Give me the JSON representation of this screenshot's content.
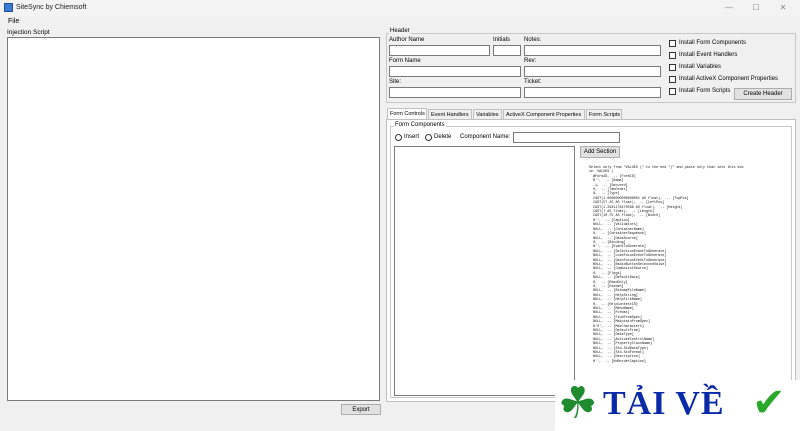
{
  "window": {
    "title": "SiteSync by Chiemsoft",
    "min_glyph": "—",
    "max_glyph": "☐",
    "close_glyph": "✕"
  },
  "menu": {
    "file": "File"
  },
  "injection": {
    "label": "Injection Script"
  },
  "export_button": "Export",
  "header": {
    "group_label": "Header",
    "author_label": "Author Name",
    "initials_label": "Initials",
    "notes_label": "Notes:",
    "form_name_label": "Form Name",
    "rev_label": "Rev:",
    "site_label": "Site:",
    "ticket_label": "Ticket:",
    "checkboxes": [
      "Install Form Components",
      "Install Event Handlers",
      "Install Variables",
      "Install ActiveX Component Properties",
      "Install Form Scripts"
    ],
    "create_button": "Create Header"
  },
  "tabs": [
    "Form Controls",
    "Event Handlers",
    "Variables",
    "ActiveX Component Properties",
    "Form Scripts"
  ],
  "form_components": {
    "group_label": "Form Components",
    "insert_label": "Insert",
    "delete_label": "Delete",
    "component_name_label": "Component Name:",
    "add_section_button": "Add Section",
    "script_text": "Select only from \"VALUES (\" to the end \")\" and paste only that into this box\nie. VALUES (\n  @FormID,  -- [FormID]\n  N'',  -- [Name]\n  -1,  -- [Secured]\n  0,  -- [TabOrder]\n  8,  -- [Type]\n  CAST(1.0800000000000001 AS float),  -- [TopPos]\n  CAST(57.25 AS float),  -- [LeftPos]\n  CAST(1.2941176470588 AS float),  -- [Height]\n  CAST(7 AS float),  -- [Length]\n  CAST(10.75 AS float),  -- [Width]\n  N'',  -- [Caption]\n  NULL,  -- [Validators]\n  NULL,  -- [ContainerName]\n  0,  -- [ContainerSequence]\n  NULL,  -- [DataSource]\n  0,  -- [Binding]\n  N'',  -- [EventToGenerate]\n  NULL,  -- [SelectionEventToGenerate]\n  NULL,  -- [LoseFocusEventToGenerate]\n  NULL,  -- [GainFocusEventToGenerate]\n  NULL,  -- [RadioButtonSelectedValue]\n  NULL,  -- [ComboListSource]\n  0,  -- [Flags]\n  NULL,  -- [DefaultData]\n  0,  -- [ReadOnly]\n  0,  -- [Hidden]\n  NULL,  -- [BitmapFileName]\n  NULL,  -- [HelpString]\n  NULL,  -- [HelpFileName]\n  0,  -- [HelpContextID]\n  NULL,  -- [MenuName]\n  NULL,  -- [Format]\n  NULL,  -- [FindFromSpec]\n  NULL,  -- [MaintainFromSpec]\n  N'0',  -- [MaxCharacters]\n  NULL,  -- [DefaultFrom]\n  NULL,  -- [DataType]\n  NULL,  -- [ActiveXControlName]\n  NULL,  -- [PropertyClassName]\n  NULL,  -- [Std.StdDataType]\n  NULL,  -- [Std.StdFormat]\n  NULL,  -- [Description]\n  N'',  -- [NoBorderCaption]"
  },
  "watermark": {
    "text": "TẢI VỀ",
    "clover_glyph": "☘",
    "check_glyph": "✔",
    "clover_color": "#1f8a2e",
    "check_color": "#2aa82a",
    "text_color": "#0b2aa8"
  }
}
